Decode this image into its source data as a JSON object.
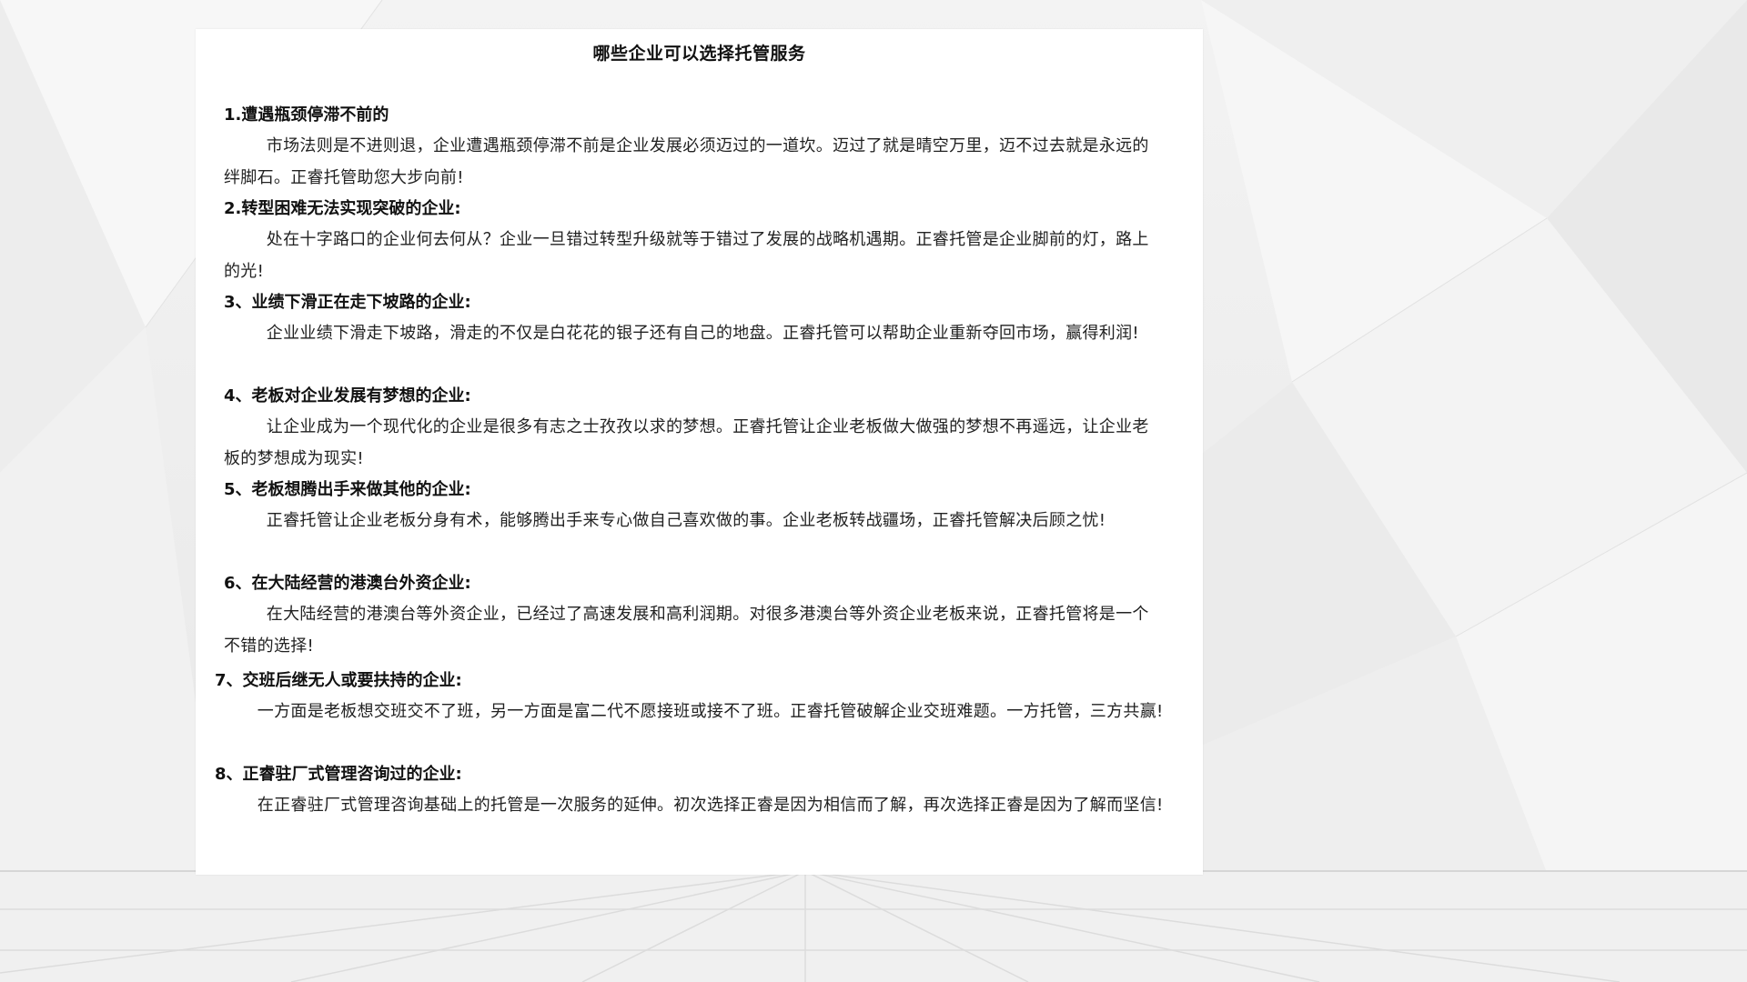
{
  "document": {
    "title": "哪些企业可以选择托管服务",
    "sections": [
      {
        "heading": "1.遭遇瓶颈停滞不前的",
        "body": "市场法则是不进则退，企业遭遇瓶颈停滞不前是企业发展必须迈过的一道坎。迈过了就是晴空万里，迈不过去就是永远的绊脚石。正睿托管助您大步向前!"
      },
      {
        "heading": "2.转型困难无法实现突破的企业:",
        "body": "处在十字路口的企业何去何从？企业一旦错过转型升级就等于错过了发展的战略机遇期。正睿托管是企业脚前的灯，路上的光!"
      },
      {
        "heading": "3、业绩下滑正在走下坡路的企业:",
        "body": "企业业绩下滑走下坡路，滑走的不仅是白花花的银子还有自己的地盘。正睿托管可以帮助企业重新夺回市场，赢得利润!"
      },
      {
        "heading": "4、老板对企业发展有梦想的企业:",
        "body": "让企业成为一个现代化的企业是很多有志之士孜孜以求的梦想。正睿托管让企业老板做大做强的梦想不再遥远，让企业老板的梦想成为现实!"
      },
      {
        "heading": "5、老板想腾出手来做其他的企业:",
        "body": "正睿托管让企业老板分身有术，能够腾出手来专心做自己喜欢做的事。企业老板转战疆场，正睿托管解决后顾之忧!"
      },
      {
        "heading": "6、在大陆经营的港澳台外资企业:",
        "body": "在大陆经营的港澳台等外资企业，已经过了高速发展和高利润期。对很多港澳台等外资企业老板来说，正睿托管将是一个不错的选择!"
      },
      {
        "heading": "7、交班后继无人或要扶持的企业:",
        "body": "一方面是老板想交班交不了班，另一方面是富二代不愿接班或接不了班。正睿托管破解企业交班难题。一方托管，三方共赢!"
      },
      {
        "heading": "8、正睿驻厂式管理咨询过的企业:",
        "body": "在正睿驻厂式管理咨询基础上的托管是一次服务的延伸。初次选择正睿是因为相信而了解，再次选择正睿是因为了解而坚信!"
      }
    ]
  }
}
